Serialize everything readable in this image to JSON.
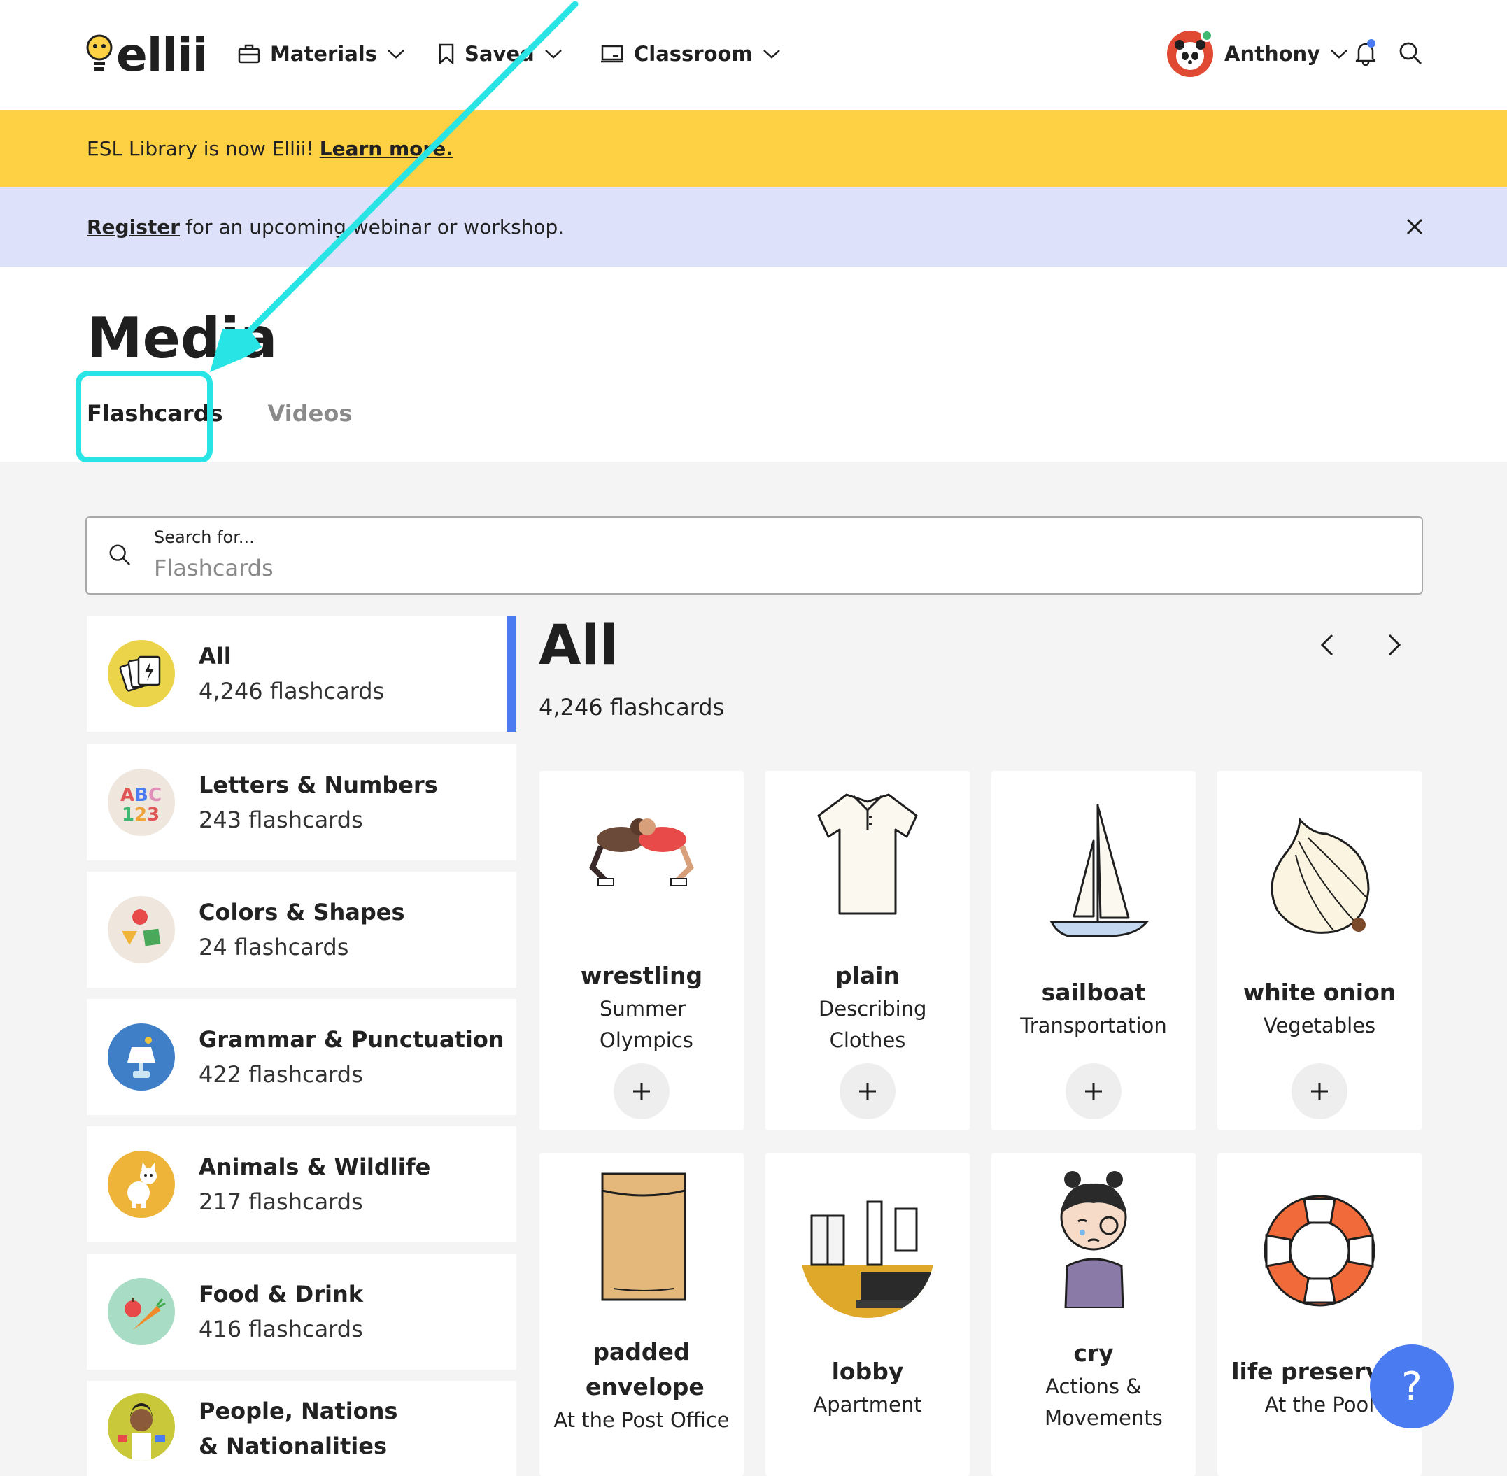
{
  "header": {
    "logo_text": "ellii",
    "nav": [
      {
        "label": "Materials",
        "icon": "briefcase-icon"
      },
      {
        "label": "Saved",
        "icon": "bookmark-icon"
      },
      {
        "label": "Classroom",
        "icon": "classroom-board-icon"
      }
    ],
    "user_name": "Anthony"
  },
  "banners": {
    "yellow_text": "ESL Library is now Ellii!",
    "yellow_link": "Learn more.",
    "purple_link": "Register",
    "purple_text": "for an upcoming webinar or workshop."
  },
  "page": {
    "title": "Media",
    "tabs": [
      "Flashcards",
      "Videos"
    ]
  },
  "search": {
    "label": "Search for...",
    "placeholder": "Flashcards"
  },
  "categories": [
    {
      "name": "All",
      "count": "4,246 flashcards"
    },
    {
      "name": "Letters & Numbers",
      "count": "243 flashcards"
    },
    {
      "name": "Colors & Shapes",
      "count": "24 flashcards"
    },
    {
      "name": "Grammar & Punctuation",
      "count": "422 flashcards"
    },
    {
      "name": "Animals & Wildlife",
      "count": "217 flashcards"
    },
    {
      "name": "Food & Drink",
      "count": "416 flashcards"
    },
    {
      "name": "People, Nations & Nationalities",
      "count": ""
    }
  ],
  "content": {
    "title": "All",
    "count": "4,246 flashcards"
  },
  "cards": [
    {
      "word": "wrestling",
      "topic": "Summer Olympics"
    },
    {
      "word": "plain",
      "topic": "Describing Clothes"
    },
    {
      "word": "sailboat",
      "topic": "Transportation"
    },
    {
      "word": "white onion",
      "topic": "Vegetables"
    },
    {
      "word": "padded envelope",
      "topic": "At the Post Office"
    },
    {
      "word": "lobby",
      "topic": "Apartment"
    },
    {
      "word": "cry",
      "topic": "Actions & Movements"
    },
    {
      "word": "life preserver",
      "topic": "At the Pool"
    }
  ],
  "help_label": "?",
  "colors": {
    "yellow_banner": "#fdd143",
    "purple_banner": "#dde2fa",
    "accent_blue": "#4a7bf0",
    "annotation_cyan": "#28e4e4"
  }
}
